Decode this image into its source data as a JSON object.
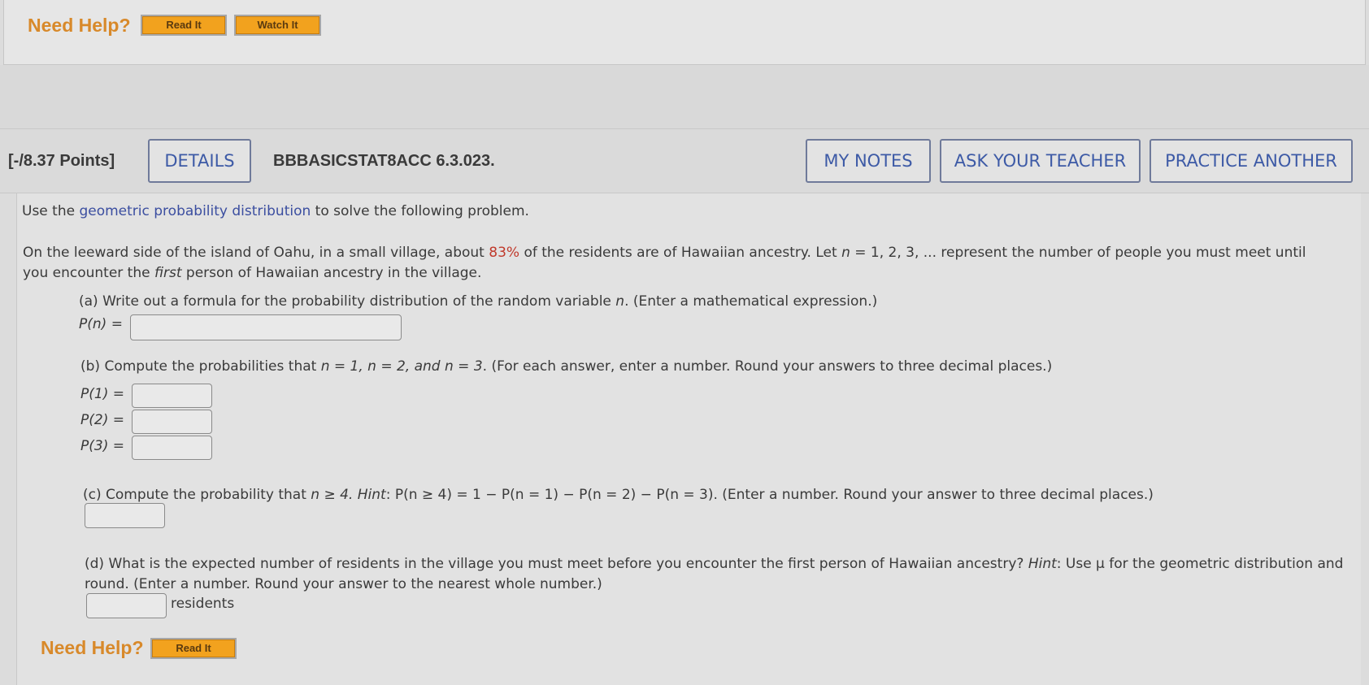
{
  "top_help": {
    "label": "Need Help?",
    "read_label": "Read It",
    "watch_label": "Watch It"
  },
  "header": {
    "points": "[-/8.37 Points]",
    "details": "DETAILS",
    "code": "BBBASICSTAT8ACC 6.3.023.",
    "my_notes": "MY NOTES",
    "ask_teacher": "ASK YOUR TEACHER",
    "practice": "PRACTICE ANOTHER"
  },
  "problem": {
    "intro_pre": "Use the ",
    "intro_link": "geometric probability distribution",
    "intro_post": " to solve the following problem.",
    "p1_a": "On the leeward side of the island of Oahu, in a small village, about ",
    "p1_pct": "83%",
    "p1_b": " of the residents are of Hawaiian ancestry. Let ",
    "p1_n": "n",
    "p1_c": " = 1, 2, 3, ... represent the number of people you must meet until",
    "p2_a": "you encounter the ",
    "p2_first": "first",
    "p2_b": " person of Hawaiian ancestry in the village."
  },
  "part_a": {
    "prompt_a": "(a) Write out a formula for the probability distribution of the random variable ",
    "prompt_n": "n",
    "prompt_b": ". (Enter a mathematical expression.)",
    "label": "P(n) ="
  },
  "part_b": {
    "prompt_a": "(b) Compute the probabilities that ",
    "prompt_vals": "n = 1, n = 2, and n = 3",
    "prompt_b": ". (For each answer, enter a number. Round your answers to three decimal places.)",
    "p1": "P(1) =",
    "p2": "P(2) =",
    "p3": "P(3) ="
  },
  "part_c": {
    "prompt_a": "(c) Compute the probability that ",
    "prompt_n": "n ≥ 4. ",
    "hint": "Hint",
    "prompt_b": ": P(n ≥ 4) = 1 − P(n = 1) − P(n = 2) − P(n = 3). (Enter a number. Round your answer to three decimal places.)"
  },
  "part_d": {
    "line1_a": "(d) What is the expected number of residents in the village you must meet before you encounter the first person of Hawaiian ancestry? ",
    "hint": "Hint",
    "line1_b": ": Use μ for the geometric distribution and",
    "line2": "round. (Enter a number. Round your answer to the nearest whole number.)",
    "unit": "residents"
  },
  "bottom_help": {
    "label": "Need Help?",
    "read_label": "Read It"
  },
  "colors": {
    "accent_orange": "#f2a21e",
    "link_blue": "#3b4ea0",
    "highlight_red": "#c0392b"
  }
}
